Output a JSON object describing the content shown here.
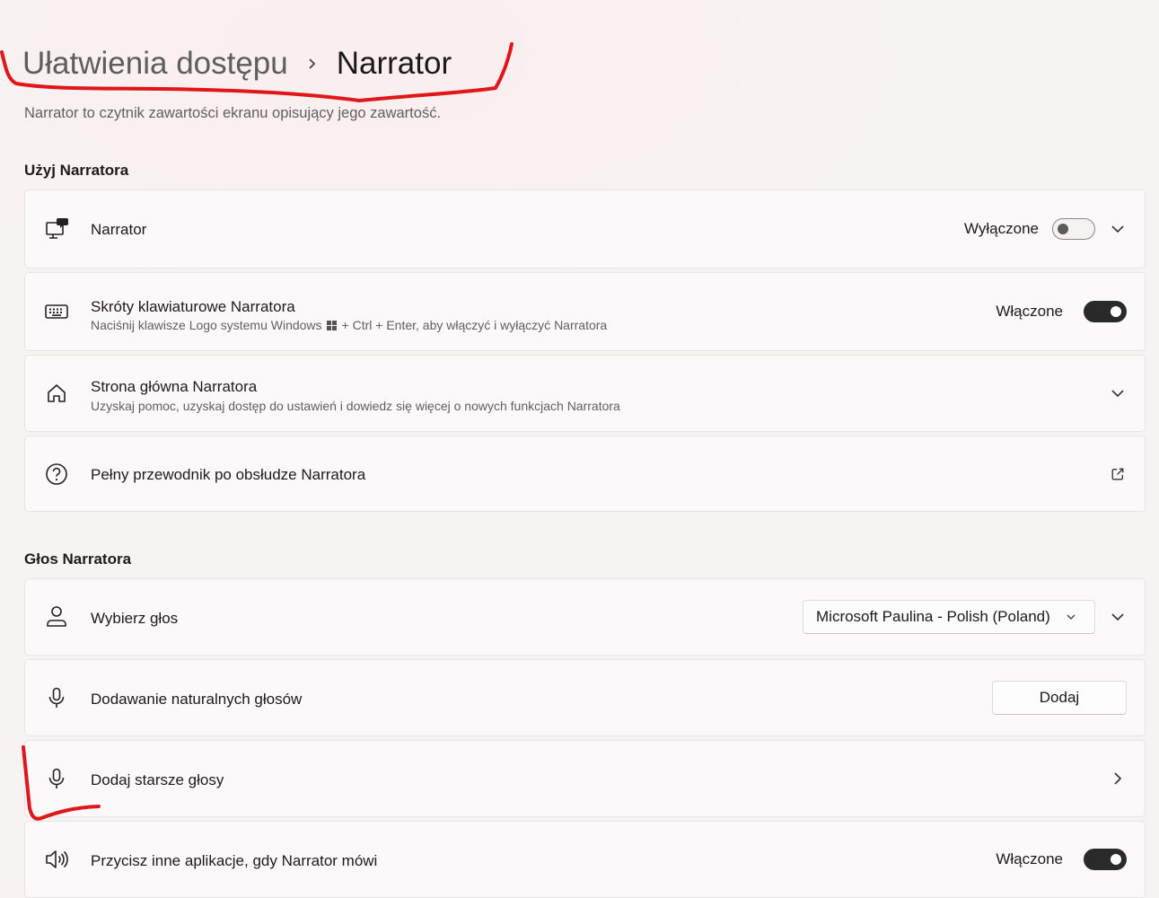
{
  "breadcrumb": {
    "parent": "Ułatwienia dostępu",
    "current": "Narrator"
  },
  "subtitle": "Narrator to czytnik zawartości ekranu opisujący jego zawartość.",
  "sections": {
    "use_narrator": "Użyj Narratora",
    "narrator_voice": "Głos Narratora"
  },
  "cards": {
    "narrator": {
      "title": "Narrator",
      "state": "Wyłączone",
      "icon": "narrator-monitor-icon"
    },
    "shortcut": {
      "title": "Skróty klawiaturowe Narratora",
      "desc_before": "Naciśnij klawisze Logo systemu Windows",
      "desc_after": "+ Ctrl + Enter, aby włączyć i wyłączyć Narratora",
      "state": "Włączone",
      "icon": "keyboard-icon"
    },
    "home": {
      "title": "Strona główna Narratora",
      "desc": "Uzyskaj pomoc, uzyskaj dostęp do ustawień i dowiedz się więcej o nowych funkcjach Narratora",
      "icon": "home-icon"
    },
    "guide": {
      "title": "Pełny przewodnik po obsłudze Narratora",
      "icon": "help-circle-icon"
    },
    "choose_voice": {
      "title": "Wybierz głos",
      "selected": "Microsoft Paulina - Polish (Poland)",
      "icon": "person-voice-icon"
    },
    "natural_voices": {
      "title": "Dodawanie naturalnych głosów",
      "button": "Dodaj",
      "icon": "microphone-icon"
    },
    "legacy_voices": {
      "title": "Dodaj starsze głosy",
      "icon": "microphone-icon"
    },
    "duck_audio": {
      "title": "Przycisz inne aplikacje, gdy Narrator mówi",
      "state": "Włączone",
      "icon": "speaker-icon"
    }
  },
  "colors": {
    "toggle_on": "#2a2a2a",
    "annotation_red": "#e0161b",
    "background": "#f7f3f3",
    "card": "#fbf9f9"
  },
  "toggles": {
    "narrator": false,
    "shortcut": true,
    "duck_audio": true
  }
}
